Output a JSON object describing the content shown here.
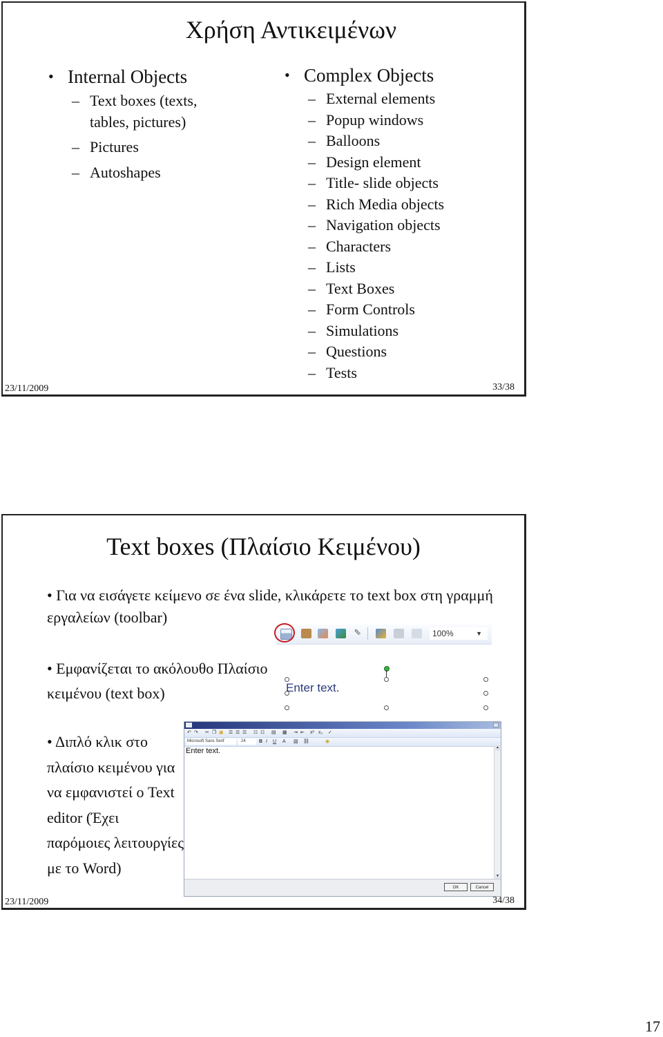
{
  "slides": [
    {
      "title": "Χρήση Αντικειμένων",
      "left_column": {
        "heading": "Internal Objects",
        "items": [
          "Text boxes (texts, tables, pictures)",
          "Pictures",
          "Autoshapes"
        ]
      },
      "right_column": {
        "heading": "Complex Objects",
        "items": [
          "External elements",
          "Popup windows",
          "Balloons",
          "Design element",
          "Title- slide objects",
          "Rich Media objects",
          "Navigation objects",
          "Characters",
          "Lists",
          "Text Boxes",
          "Form Controls",
          "Simulations",
          "Questions",
          "Tests"
        ]
      },
      "footer": {
        "date": "23/11/2009",
        "page": "33/38"
      }
    },
    {
      "title": "Text boxes (Πλαίσιο Κειμένου)",
      "paragraphs": {
        "intro": "• Για να εισάγετε κείμενο σε ένα slide, κλικάρετε το text box στη γραμμή εργαλείων (toolbar)",
        "appears": "• Εμφανίζεται το ακόλουθο Πλαίσιο κειμένου (text box)",
        "dblclick": "• Διπλό κλικ στο πλαίσιο κειμένου για να εμφανιστεί ο Text editor (Έχει παρόμοιες λειτουργίες με το Word)"
      },
      "toolbar": {
        "icons": [
          "text-box-icon",
          "character-icon",
          "picture-icon",
          "media-icon",
          "pointer-icon",
          "paint-icon",
          "stack-icon",
          "effects-icon"
        ],
        "zoom_value": "100%",
        "highlight_color": "#c8181e"
      },
      "textbox_preview": {
        "text": "Enter text."
      },
      "editor": {
        "font_name": "Microsoft Sans Serif",
        "font_size": "24",
        "body_text": "Enter text.",
        "ok_label": "OK",
        "cancel_label": "Cancel"
      },
      "footer": {
        "date": "23/11/2009",
        "page": "34/38"
      }
    }
  ],
  "document_page_number": "17"
}
